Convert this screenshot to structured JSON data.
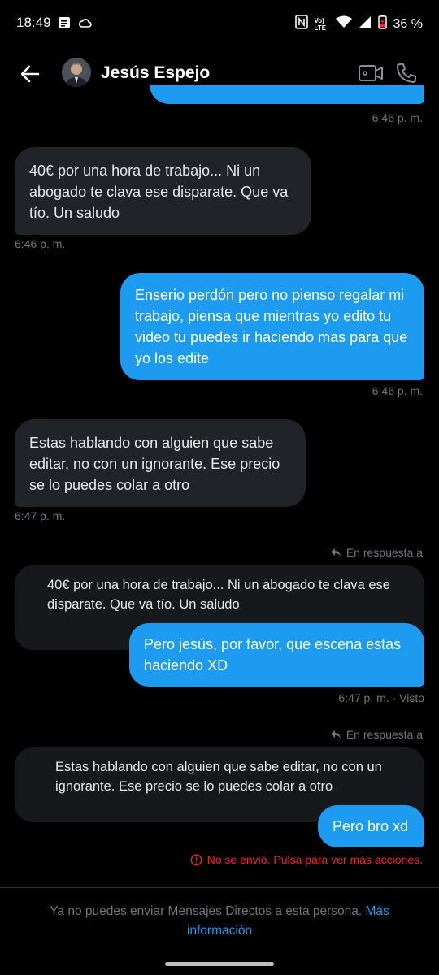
{
  "status": {
    "time": "18:49",
    "network": "Vo) LTE",
    "battery": "36 %"
  },
  "header": {
    "name": "Jesús Espejo"
  },
  "messages": {
    "m0_ts": "6:46 p. m.",
    "m1_text": "40€ por una hora de trabajo... Ni un abogado te clava ese disparate. Que va tío. Un saludo",
    "m1_ts": "6:46 p. m.",
    "m2_text": "Enserio perdón pero no pienso regalar mi trabajo, piensa que mientras yo edito tu video tu puedes ir haciendo mas para que yo los edite",
    "m2_ts": "6:46 p. m.",
    "m3_text": "Estas hablando con alguien que sabe editar, no con un ignorante. Ese precio se lo puedes colar a otro",
    "m3_ts": "6:47 p. m.",
    "m4_reply_label": "En respuesta a",
    "m4_quote": "40€ por una hora de trabajo... Ni un abogado te clava ese disparate. Que va tío. Un saludo",
    "m4_text": "Pero jesús, por favor, que escena estas haciendo XD",
    "m4_ts": "6:47 p. m. · Visto",
    "m5_reply_label": "En respuesta a",
    "m5_quote": "Estas hablando con alguien que sabe editar, no con un ignorante. Ese precio se lo puedes colar a otro",
    "m5_text": "Pero bro xd",
    "m5_error": "No se envió. Pulsa para ver más acciones."
  },
  "footer": {
    "text": "Ya no puedes enviar Mensajes Directos a esta persona. ",
    "link": "Más información"
  },
  "colors": {
    "accent": "#1d9bf0",
    "incoming": "#202327",
    "error": "#f4212e"
  }
}
